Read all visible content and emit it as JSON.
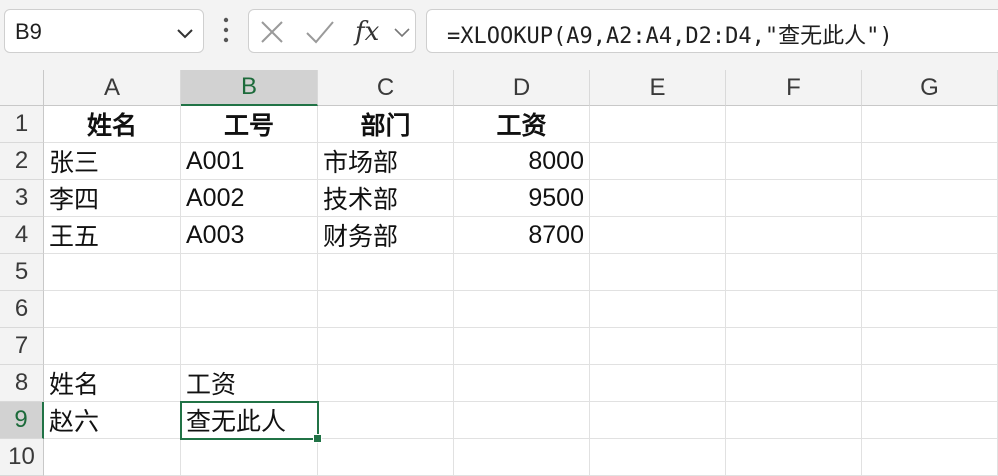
{
  "name_box": {
    "value": "B9"
  },
  "formula_bar": {
    "formula": "=XLOOKUP(A9,A2:A4,D2:D4,\"查无此人\")",
    "cancel_icon": "close-icon",
    "enter_icon": "check-icon",
    "fx_icon": "function-icon"
  },
  "columns": [
    "A",
    "B",
    "C",
    "D",
    "E",
    "F",
    "G"
  ],
  "rows": [
    "1",
    "2",
    "3",
    "4",
    "5",
    "6",
    "7",
    "8",
    "9",
    "10"
  ],
  "selected": {
    "column": "B",
    "row": "9"
  },
  "cells": {
    "r1": [
      "姓名",
      "工号",
      "部门",
      "工资"
    ],
    "r2": [
      "张三",
      "A001",
      "市场部",
      "8000"
    ],
    "r3": [
      "李四",
      "A002",
      "技术部",
      "9500"
    ],
    "r4": [
      "王五",
      "A003",
      "财务部",
      "8700"
    ],
    "r8": [
      "姓名",
      "工资"
    ],
    "r9": [
      "赵六",
      "查无此人"
    ]
  },
  "colors": {
    "accent": "#217346",
    "header_bg": "#f3f3f3",
    "selected_header_bg": "#d2d2d2"
  }
}
